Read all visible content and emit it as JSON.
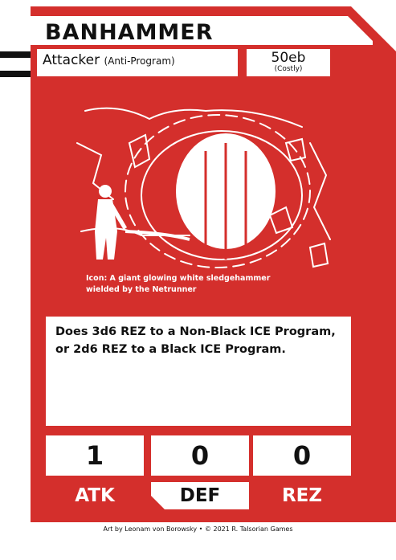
{
  "card": {
    "title": "BANHAMMER",
    "type": "Attacker",
    "subtype": "(Anti-Program)",
    "cost": "50eb",
    "cost_note": "(Costly)",
    "art_caption": "Icon: A giant glowing white sledgehammer wielded by the Netrunner",
    "rules_text": "Does 3d6 REZ to a Non-Black ICE Program, or 2d6 REZ to a Black ICE Program.",
    "stats": [
      {
        "label": "ATK",
        "value": "1"
      },
      {
        "label": "DEF",
        "value": "0"
      },
      {
        "label": "REZ",
        "value": "0"
      }
    ],
    "footer": "Art by Leonam von Borowsky • © 2021 R. Talsorian Games"
  },
  "colors": {
    "card_red": "#d42f2c",
    "panel_white": "#ffffff",
    "text_dark": "#111111"
  }
}
